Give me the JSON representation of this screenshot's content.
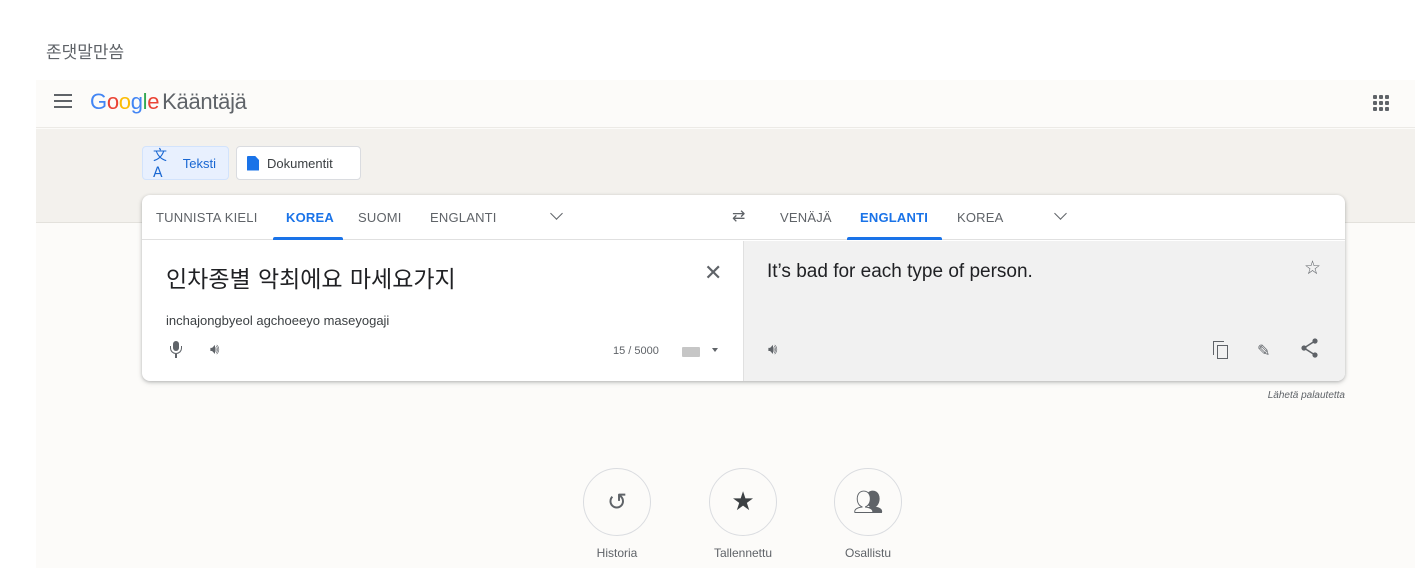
{
  "post_title": "존댓말만씀",
  "header": {
    "logo_letters": [
      "G",
      "o",
      "o",
      "g",
      "l",
      "e"
    ],
    "product_name": "Kääntäjä",
    "menu_icon": "hamburger-menu-icon",
    "apps_icon": "apps-grid-icon"
  },
  "modes": {
    "text_label": "Teksti",
    "documents_label": "Dokumentit",
    "active": "Teksti"
  },
  "source_languages": {
    "tabs": [
      "TUNNISTA KIELI",
      "KOREA",
      "SUOMI",
      "ENGLANTI"
    ],
    "active": "KOREA"
  },
  "target_languages": {
    "tabs": [
      "VENÄJÄ",
      "ENGLANTI",
      "KOREA"
    ],
    "active": "ENGLANTI"
  },
  "source": {
    "text": "인차종별 악최에요 마세요가지",
    "transliteration": "inchajongbyeol agchoeeyo maseyogaji",
    "char_count": "15 / 5000"
  },
  "target": {
    "text": "It’s bad for each type of person."
  },
  "feedback_label": "Lähetä palautetta",
  "bottom": {
    "history_label": "Historia",
    "saved_label": "Tallennettu",
    "contribute_label": "Osallistu"
  },
  "colors": {
    "accent": "#1a73e8",
    "active_chip_bg": "#e8f0fe",
    "target_panel_bg": "#f1f1f1",
    "band_bg": "#f3f1ed"
  }
}
